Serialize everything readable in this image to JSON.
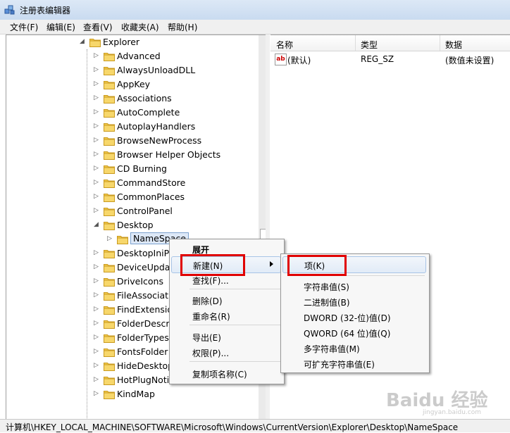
{
  "window": {
    "title": "注册表编辑器"
  },
  "menubar": [
    "文件(F)",
    "编辑(E)",
    "查看(V)",
    "收藏夹(A)",
    "帮助(H)"
  ],
  "tree": {
    "parent": "Explorer",
    "items": [
      "Advanced",
      "AlwaysUnloadDLL",
      "AppKey",
      "Associations",
      "AutoComplete",
      "AutoplayHandlers",
      "BrowseNewProcess",
      "Browser Helper Objects",
      "CD Burning",
      "CommandStore",
      "CommonPlaces",
      "ControlPanel",
      "Desktop",
      "NameSpace",
      "DesktopIniP",
      "DeviceUpda",
      "DriveIcons",
      "FileAssociati",
      "FindExtensio",
      "FolderDescr",
      "FolderTypes",
      "FontsFolder",
      "HideDesktop",
      "HotPlugNoti",
      "KindMap"
    ]
  },
  "list": {
    "headers": {
      "name": "名称",
      "type": "类型",
      "data": "数据"
    },
    "rows": [
      {
        "name": "(默认)",
        "type": "REG_SZ",
        "data": "(数值未设置)",
        "icon": "ab"
      }
    ]
  },
  "context_menu": {
    "items": [
      "展开",
      "新建(N)",
      "查找(F)...",
      "删除(D)",
      "重命名(R)",
      "导出(E)",
      "权限(P)...",
      "复制项名称(C)"
    ]
  },
  "submenu": {
    "items": [
      "项(K)",
      "字符串值(S)",
      "二进制值(B)",
      "DWORD (32-位)值(D)",
      "QWORD (64 位)值(Q)",
      "多字符串值(M)",
      "可扩充字符串值(E)"
    ]
  },
  "statusbar": {
    "path": "计算机\\HKEY_LOCAL_MACHINE\\SOFTWARE\\Microsoft\\Windows\\CurrentVersion\\Explorer\\Desktop\\NameSpace"
  },
  "watermark": {
    "text": "Baidu 经验",
    "sub": "jingyan.baidu.com"
  },
  "colors": {
    "highlight_box": "#e00000",
    "folder": "#f2c94c"
  }
}
